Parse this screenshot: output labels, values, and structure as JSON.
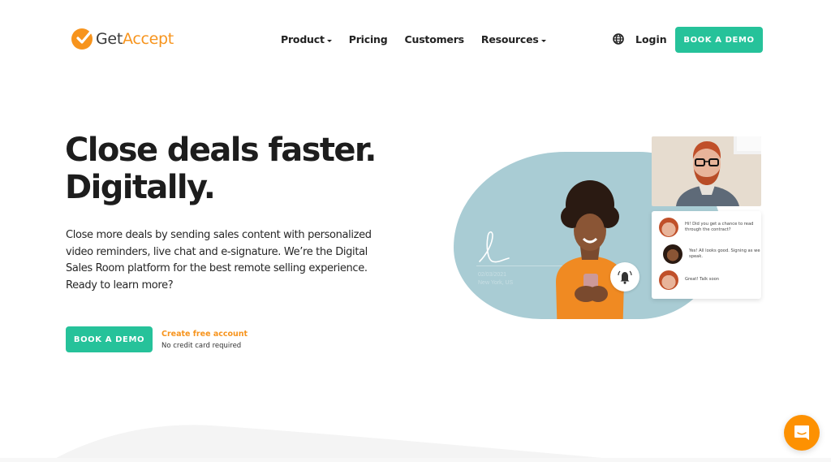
{
  "brand": {
    "name_part1": "Get",
    "name_part2": "Accept",
    "logo_icon": "checkmark-circle-icon",
    "accent_color": "#f7941d",
    "cta_color": "#26c29a"
  },
  "nav": {
    "items": [
      {
        "label": "Product",
        "has_dropdown": true
      },
      {
        "label": "Pricing",
        "has_dropdown": false
      },
      {
        "label": "Customers",
        "has_dropdown": false
      },
      {
        "label": "Resources",
        "has_dropdown": true
      }
    ],
    "language_icon": "globe-icon",
    "login_label": "Login",
    "cta_label": "BOOK A DEMO"
  },
  "hero": {
    "title_line1": "Close deals faster.",
    "title_line2": "Digitally.",
    "body": "Close more deals by sending sales content with personalized video reminders, live chat and e-signature. We’re the Digital Sales Room platform for the best remote selling experience. Ready to learn more?",
    "cta_label": "BOOK A DEMO",
    "secondary_link": "Create free account",
    "secondary_note": "No credit card required"
  },
  "illustration": {
    "signature_meta_line1": "02/03/2021",
    "signature_meta_line2": "New York, US",
    "notification_icon": "bell-icon",
    "chat": [
      {
        "sender": "man",
        "text": "Hi! Did you get a chance to read through the contract?"
      },
      {
        "sender": "woman",
        "text": "Yes! All looks good. Signing as we speak."
      },
      {
        "sender": "man",
        "text": "Great! Talk soon"
      }
    ]
  },
  "chat_launcher": {
    "icon": "chat-bubble-icon",
    "color": "#fd9102"
  }
}
